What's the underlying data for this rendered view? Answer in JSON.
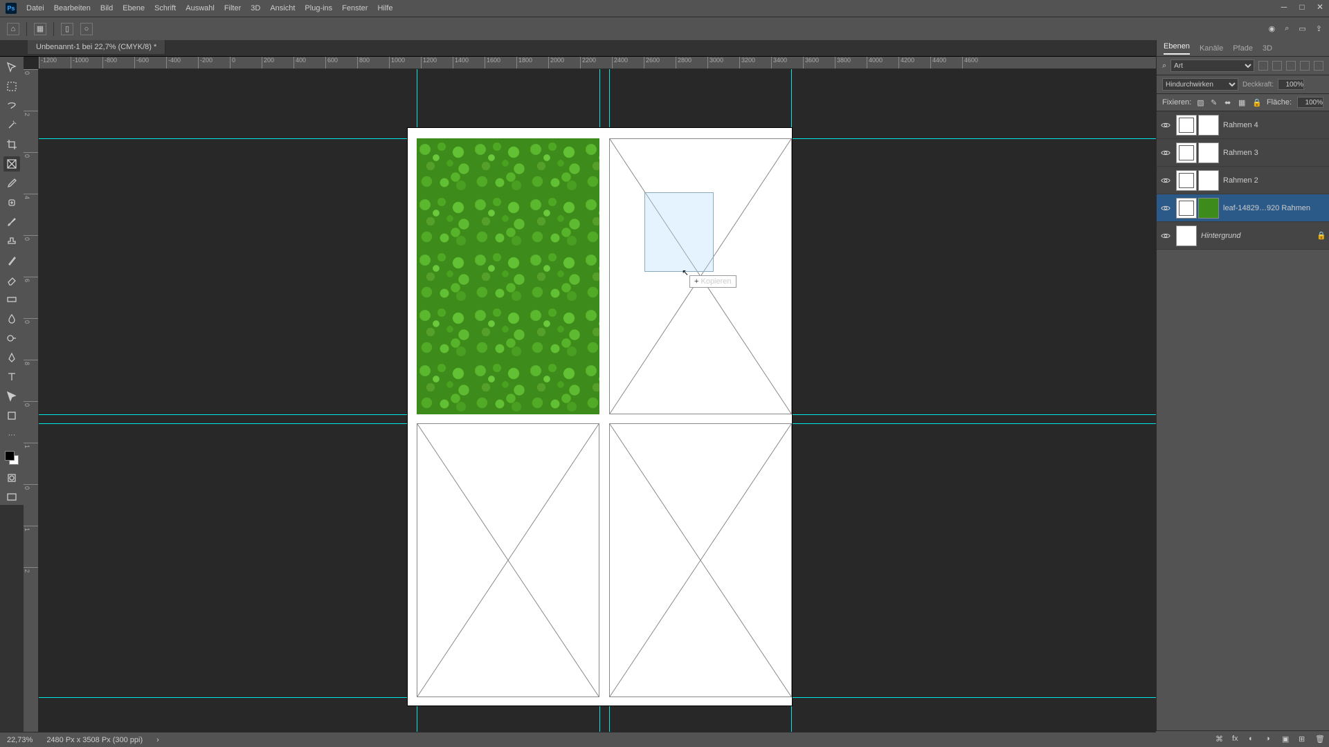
{
  "app_logo": "Ps",
  "menu": [
    "Datei",
    "Bearbeiten",
    "Bild",
    "Ebene",
    "Schrift",
    "Auswahl",
    "Filter",
    "3D",
    "Ansicht",
    "Plug-ins",
    "Fenster",
    "Hilfe"
  ],
  "doc_tab": "Unbenannt-1 bei 22,7% (CMYK/8) *",
  "ruler_h": [
    "-1200",
    "-1000",
    "-800",
    "-600",
    "-400",
    "-200",
    "0",
    "200",
    "400",
    "600",
    "800",
    "1000",
    "1200",
    "1400",
    "1600",
    "1800",
    "2000",
    "2200",
    "2400",
    "2600",
    "2800",
    "3000",
    "3200",
    "3400",
    "3600",
    "3800",
    "4000",
    "4200",
    "4400",
    "4600"
  ],
  "ruler_v": [
    "0",
    "2",
    "0",
    "4",
    "0",
    "6",
    "0",
    "8",
    "0",
    "1",
    "0",
    "1",
    "2"
  ],
  "panel_tabs": [
    "Ebenen",
    "Kanäle",
    "Pfade",
    "3D"
  ],
  "layers_filter_label": "Art",
  "blend_mode": "Hindurchwirken",
  "opacity_label": "Deckkraft:",
  "opacity_value": "100%",
  "lock_label": "Fixieren:",
  "fill_label": "Fläche:",
  "fill_value": "100%",
  "layers": [
    {
      "name": "Rahmen 4",
      "type": "frame"
    },
    {
      "name": "Rahmen 3",
      "type": "frame"
    },
    {
      "name": "Rahmen 2",
      "type": "frame"
    },
    {
      "name": "leaf-14829…920 Rahmen",
      "type": "image",
      "selected": true
    },
    {
      "name": "Hintergrund",
      "type": "bg",
      "locked": true
    }
  ],
  "tooltip_text": "Kopieren",
  "status_zoom": "22,73%",
  "status_docinfo": "2480 Px x 3508 Px (300 ppi)"
}
